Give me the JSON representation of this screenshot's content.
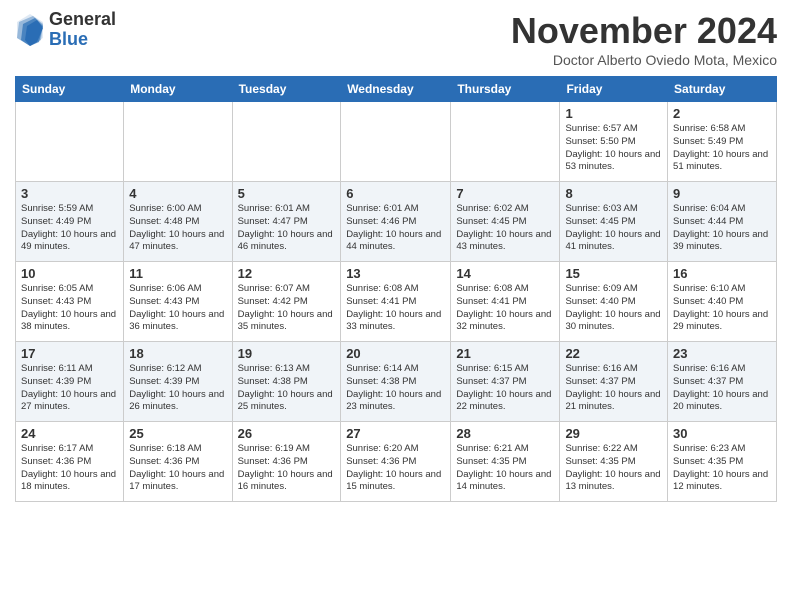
{
  "header": {
    "logo": {
      "general": "General",
      "blue": "Blue"
    },
    "title": "November 2024",
    "location": "Doctor Alberto Oviedo Mota, Mexico"
  },
  "days_of_week": [
    "Sunday",
    "Monday",
    "Tuesday",
    "Wednesday",
    "Thursday",
    "Friday",
    "Saturday"
  ],
  "weeks": [
    [
      {
        "day": "",
        "info": ""
      },
      {
        "day": "",
        "info": ""
      },
      {
        "day": "",
        "info": ""
      },
      {
        "day": "",
        "info": ""
      },
      {
        "day": "",
        "info": ""
      },
      {
        "day": "1",
        "info": "Sunrise: 6:57 AM\nSunset: 5:50 PM\nDaylight: 10 hours and 53 minutes."
      },
      {
        "day": "2",
        "info": "Sunrise: 6:58 AM\nSunset: 5:49 PM\nDaylight: 10 hours and 51 minutes."
      }
    ],
    [
      {
        "day": "3",
        "info": "Sunrise: 5:59 AM\nSunset: 4:49 PM\nDaylight: 10 hours and 49 minutes."
      },
      {
        "day": "4",
        "info": "Sunrise: 6:00 AM\nSunset: 4:48 PM\nDaylight: 10 hours and 47 minutes."
      },
      {
        "day": "5",
        "info": "Sunrise: 6:01 AM\nSunset: 4:47 PM\nDaylight: 10 hours and 46 minutes."
      },
      {
        "day": "6",
        "info": "Sunrise: 6:01 AM\nSunset: 4:46 PM\nDaylight: 10 hours and 44 minutes."
      },
      {
        "day": "7",
        "info": "Sunrise: 6:02 AM\nSunset: 4:45 PM\nDaylight: 10 hours and 43 minutes."
      },
      {
        "day": "8",
        "info": "Sunrise: 6:03 AM\nSunset: 4:45 PM\nDaylight: 10 hours and 41 minutes."
      },
      {
        "day": "9",
        "info": "Sunrise: 6:04 AM\nSunset: 4:44 PM\nDaylight: 10 hours and 39 minutes."
      }
    ],
    [
      {
        "day": "10",
        "info": "Sunrise: 6:05 AM\nSunset: 4:43 PM\nDaylight: 10 hours and 38 minutes."
      },
      {
        "day": "11",
        "info": "Sunrise: 6:06 AM\nSunset: 4:43 PM\nDaylight: 10 hours and 36 minutes."
      },
      {
        "day": "12",
        "info": "Sunrise: 6:07 AM\nSunset: 4:42 PM\nDaylight: 10 hours and 35 minutes."
      },
      {
        "day": "13",
        "info": "Sunrise: 6:08 AM\nSunset: 4:41 PM\nDaylight: 10 hours and 33 minutes."
      },
      {
        "day": "14",
        "info": "Sunrise: 6:08 AM\nSunset: 4:41 PM\nDaylight: 10 hours and 32 minutes."
      },
      {
        "day": "15",
        "info": "Sunrise: 6:09 AM\nSunset: 4:40 PM\nDaylight: 10 hours and 30 minutes."
      },
      {
        "day": "16",
        "info": "Sunrise: 6:10 AM\nSunset: 4:40 PM\nDaylight: 10 hours and 29 minutes."
      }
    ],
    [
      {
        "day": "17",
        "info": "Sunrise: 6:11 AM\nSunset: 4:39 PM\nDaylight: 10 hours and 27 minutes."
      },
      {
        "day": "18",
        "info": "Sunrise: 6:12 AM\nSunset: 4:39 PM\nDaylight: 10 hours and 26 minutes."
      },
      {
        "day": "19",
        "info": "Sunrise: 6:13 AM\nSunset: 4:38 PM\nDaylight: 10 hours and 25 minutes."
      },
      {
        "day": "20",
        "info": "Sunrise: 6:14 AM\nSunset: 4:38 PM\nDaylight: 10 hours and 23 minutes."
      },
      {
        "day": "21",
        "info": "Sunrise: 6:15 AM\nSunset: 4:37 PM\nDaylight: 10 hours and 22 minutes."
      },
      {
        "day": "22",
        "info": "Sunrise: 6:16 AM\nSunset: 4:37 PM\nDaylight: 10 hours and 21 minutes."
      },
      {
        "day": "23",
        "info": "Sunrise: 6:16 AM\nSunset: 4:37 PM\nDaylight: 10 hours and 20 minutes."
      }
    ],
    [
      {
        "day": "24",
        "info": "Sunrise: 6:17 AM\nSunset: 4:36 PM\nDaylight: 10 hours and 18 minutes."
      },
      {
        "day": "25",
        "info": "Sunrise: 6:18 AM\nSunset: 4:36 PM\nDaylight: 10 hours and 17 minutes."
      },
      {
        "day": "26",
        "info": "Sunrise: 6:19 AM\nSunset: 4:36 PM\nDaylight: 10 hours and 16 minutes."
      },
      {
        "day": "27",
        "info": "Sunrise: 6:20 AM\nSunset: 4:36 PM\nDaylight: 10 hours and 15 minutes."
      },
      {
        "day": "28",
        "info": "Sunrise: 6:21 AM\nSunset: 4:35 PM\nDaylight: 10 hours and 14 minutes."
      },
      {
        "day": "29",
        "info": "Sunrise: 6:22 AM\nSunset: 4:35 PM\nDaylight: 10 hours and 13 minutes."
      },
      {
        "day": "30",
        "info": "Sunrise: 6:23 AM\nSunset: 4:35 PM\nDaylight: 10 hours and 12 minutes."
      }
    ]
  ]
}
